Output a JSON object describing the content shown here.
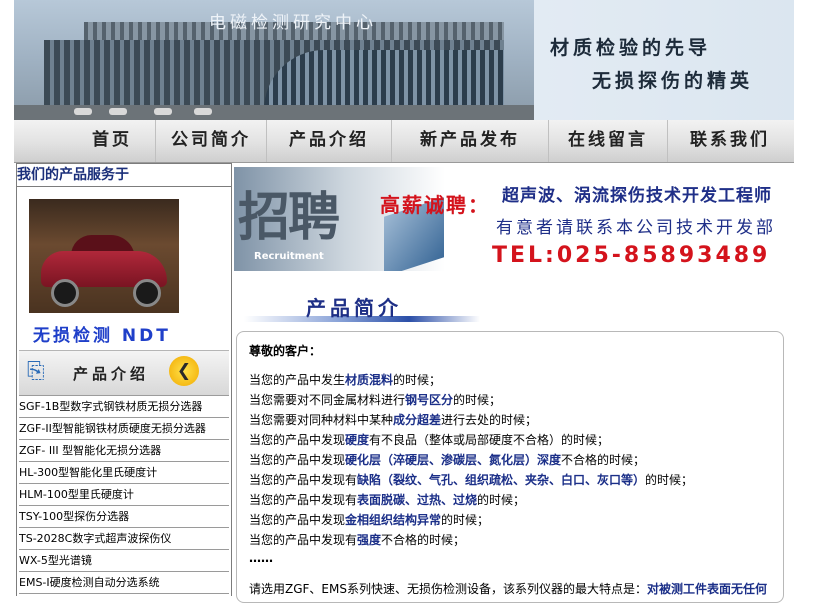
{
  "banner": {
    "title": "电磁检测研究中心",
    "slogan1": "材质检验的先导",
    "slogan2": "无损探伤的精英"
  },
  "nav": {
    "items": [
      "首页",
      "公司简介",
      "产品介绍",
      "新产品发布",
      "在线留言",
      "联系我们"
    ]
  },
  "sidebar": {
    "title": "我们的产品服务于",
    "ndt_caption": "无损检测 NDT",
    "products_header": "产品介绍",
    "products": [
      "SGF-1B型数字式钢铁材质无损分选器",
      "ZGF-II型智能钢铁材质硬度无损分选器",
      "ZGF- III 型智能化无损分选器",
      "HL-300型智能化里氏硬度计",
      "HLM-100型里氏硬度计",
      "TSY-100型探伤分选器",
      "TS-2028C数字式超声波探伤仪",
      "WX-5型光谱镜",
      "EMS-Ⅰ硬度检测自动分选系统"
    ]
  },
  "recruit": {
    "big": "招聘",
    "en": "Recruitment",
    "gaoxin": "高薪诚聘：",
    "line1": "超声波、涡流探伤技术开发工程师",
    "line2": "有意者请联系本公司技术开发部",
    "line3": "TEL:025-85893489"
  },
  "main": {
    "section_title": "产品简介",
    "greeting": "尊敬的客户：",
    "lines": [
      {
        "pre": "当您的产品中发生",
        "hl": "材质混料",
        "post": "的时候；"
      },
      {
        "pre": "当您需要对不同金属材料进行",
        "hl": "钢号区分",
        "post": "的时候；"
      },
      {
        "pre": "当您需要对同种材料中某种",
        "hl": "成分超差",
        "post": "进行去处的时候；"
      },
      {
        "pre": "当您的产品中发现",
        "hl": "硬度",
        "post": "有不良品（整体或局部硬度不合格）的时候；"
      },
      {
        "pre": "当您的产品中发现",
        "hl": "硬化层（淬硬层、渗碳层、氮化层）深度",
        "post": "不合格的时候；"
      },
      {
        "pre": "当您的产品中发现有",
        "hl": "缺陷（裂纹、气孔、组织疏松、夹杂、白口、灰口等）",
        "post": "的时候；"
      },
      {
        "pre": "当您的产品中发现有",
        "hl": "表面脱碳、过热、过烧",
        "post": "的时候；"
      },
      {
        "pre": "当您的产品中发现",
        "hl": "金相组织结构异常",
        "post": "的时候；"
      },
      {
        "pre": "当您的产品中发现有",
        "hl": "强度",
        "post": "不合格的时候；"
      }
    ],
    "ellipsis": "……",
    "bottom_pre": "请选用ZGF、EMS系列快速、无损伤检测设备，该系列仪器的最大特点是：",
    "bottom_hl": "对被测工件表面无任何"
  }
}
